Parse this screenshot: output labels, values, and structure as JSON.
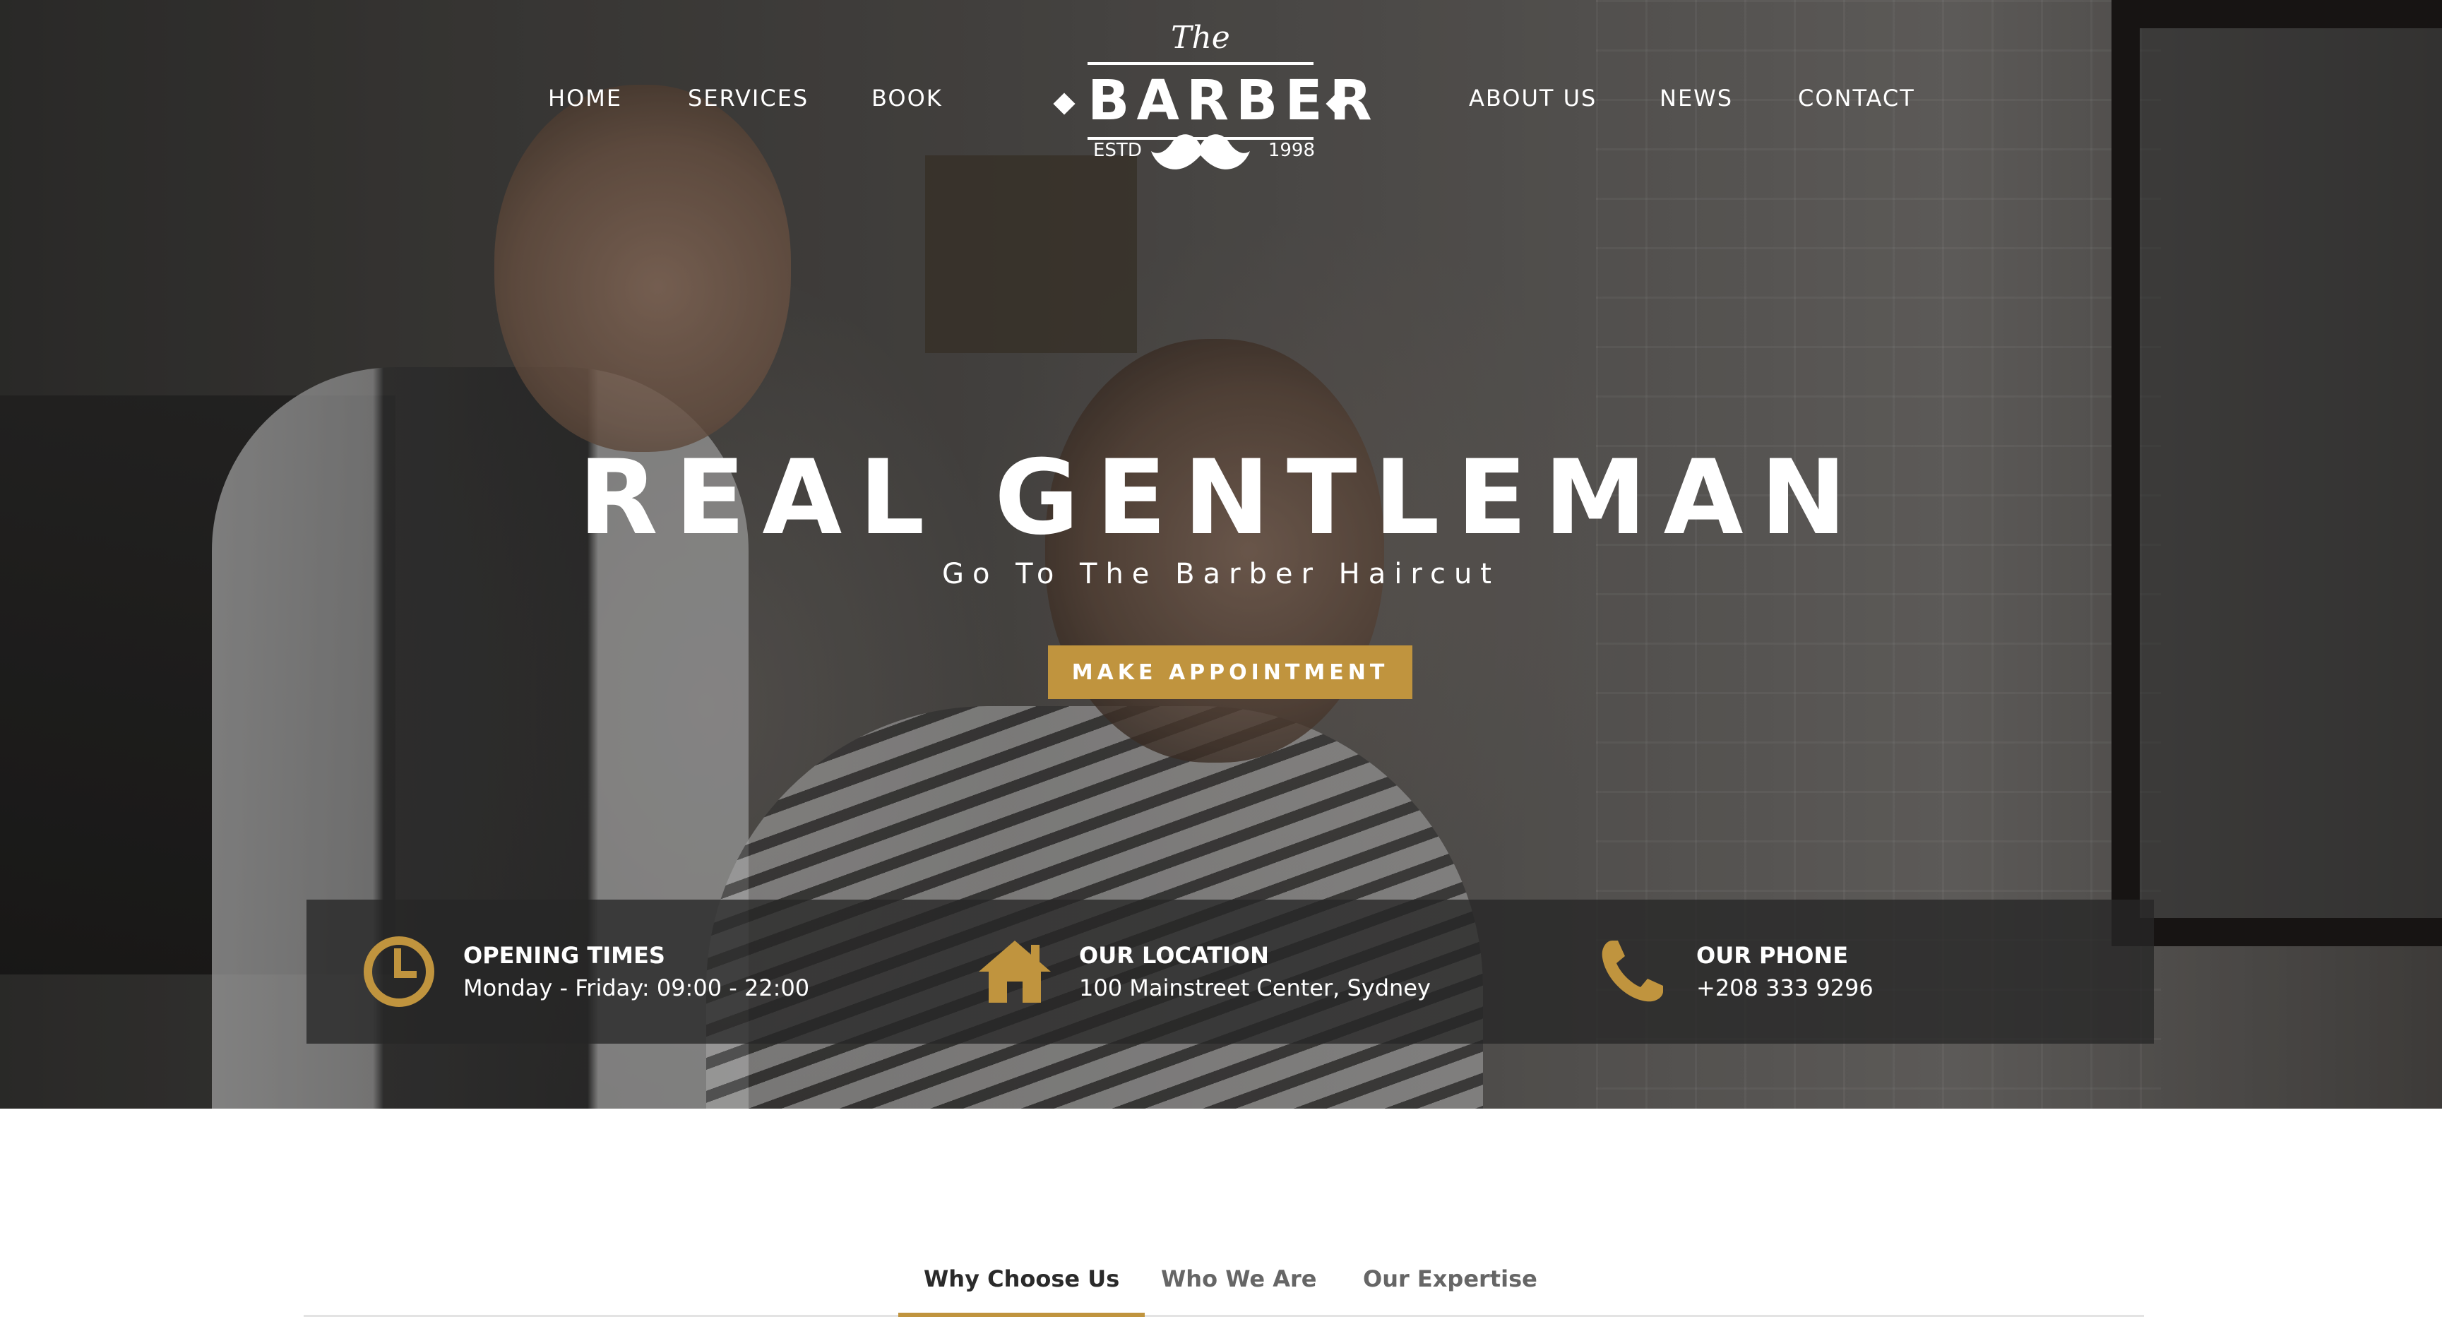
{
  "colors": {
    "accent": "#c0943e",
    "white": "#ffffff",
    "info_bar": "#262626"
  },
  "nav": {
    "left": [
      {
        "label": "HOME"
      },
      {
        "label": "SERVICES"
      },
      {
        "label": "BOOK"
      }
    ],
    "right": [
      {
        "label": "ABOUT US"
      },
      {
        "label": "NEWS"
      },
      {
        "label": "CONTACT"
      }
    ]
  },
  "logo": {
    "the": "The",
    "barber": "BARBER",
    "estd": "ESTD",
    "year": "1998",
    "icon": "mustache-icon"
  },
  "hero": {
    "title": "REAL GENTLEMAN",
    "subtitle": "Go To The Barber Haircut",
    "cta_label": "MAKE APPOINTMENT"
  },
  "info": [
    {
      "icon": "clock-icon",
      "label": "OPENING TIMES",
      "value": "Monday - Friday: 09:00 - 22:00"
    },
    {
      "icon": "home-icon",
      "label": "OUR LOCATION",
      "value": "100 Mainstreet Center, Sydney"
    },
    {
      "icon": "phone-icon",
      "label": "OUR PHONE",
      "value": "+208 333 9296"
    }
  ],
  "tabs": [
    {
      "label": "Why Choose Us",
      "active": true
    },
    {
      "label": "Who We Are",
      "active": false
    },
    {
      "label": "Our Expertise",
      "active": false
    }
  ]
}
